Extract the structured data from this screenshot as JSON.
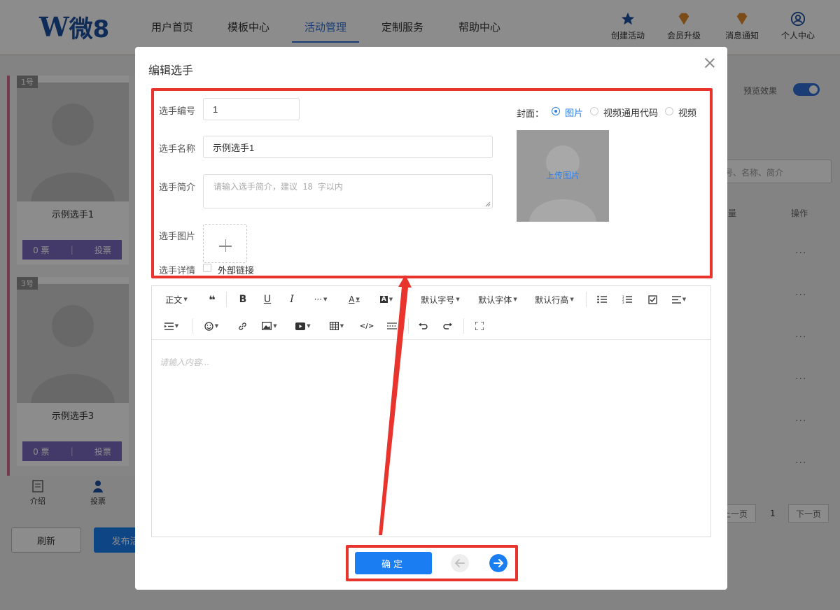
{
  "app": {
    "logo_w": "W",
    "logo_text": "微8"
  },
  "nav": {
    "items": [
      "用户首页",
      "模板中心",
      "活动管理",
      "定制服务",
      "帮助中心"
    ],
    "active_index": 2
  },
  "tools": [
    {
      "label": "创建活动",
      "icon": "star-icon"
    },
    {
      "label": "会员升级",
      "icon": "diamond-icon"
    },
    {
      "label": "消息通知",
      "icon": "diamond-icon"
    },
    {
      "label": "个人中心",
      "icon": "user-circle-icon"
    }
  ],
  "background": {
    "cards": [
      {
        "num": "1号",
        "name": "示例选手1",
        "votes": "0 票",
        "vote_label": "投票"
      },
      {
        "num": "3号",
        "name": "示例选手3",
        "votes": "0 票",
        "vote_label": "投票"
      }
    ],
    "bottom_tabs": [
      {
        "label": "介绍",
        "icon": "document-icon"
      },
      {
        "label": "投票",
        "icon": "user-icon"
      }
    ],
    "refresh_label": "刷新",
    "publish_label": "发布活",
    "preview_label": "预览效果",
    "search_placeholder": "号、名称、简介",
    "col_count": "量",
    "col_ops": "操作",
    "row_ops": "···",
    "pager_prev": "上一页",
    "pager_page": "1",
    "pager_next": "下一页"
  },
  "modal": {
    "title": "编辑选手",
    "fields": {
      "number_label": "选手编号",
      "number_value": "1",
      "name_label": "选手名称",
      "name_value": "示例选手1",
      "intro_label": "选手简介",
      "intro_placeholder": "请输入选手简介，建议 18 字以内",
      "image_label": "选手图片",
      "detail_label": "选手详情",
      "external_link_label": "外部链接"
    },
    "cover": {
      "label": "封面：",
      "options": [
        "图片",
        "视频通用代码",
        "视频"
      ],
      "selected_index": 0,
      "upload_label": "上传图片"
    },
    "toolbar": {
      "row1": [
        "正文",
        "“",
        "B",
        "U",
        "I",
        "···",
        "A",
        "A",
        "默认字号",
        "默认字体",
        "默认行高"
      ],
      "body_label": "正文",
      "font_size_label": "默认字号",
      "font_family_label": "默认字体",
      "line_height_label": "默认行高"
    },
    "editor_placeholder": "请输入内容...",
    "confirm_label": "确定"
  },
  "colors": {
    "accent": "#1a7ef2",
    "highlight": "#e8342c",
    "vote_button": "#7c6ac0"
  }
}
